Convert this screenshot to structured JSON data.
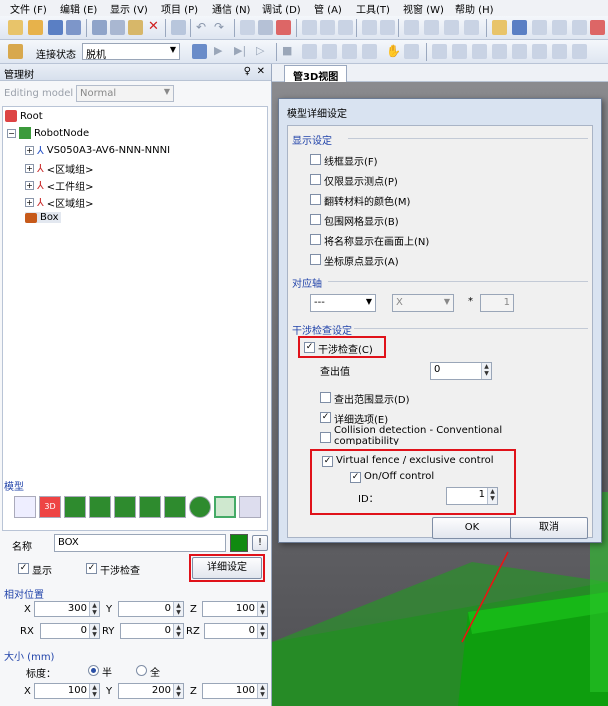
{
  "menu": [
    "文件 (F)",
    "编辑 (E)",
    "显示 (V)",
    "项目 (P)",
    "通信 (N)",
    "调试 (D)",
    "管 (A)",
    "工具(T)",
    "视窗 (W)",
    "帮助 (H)"
  ],
  "toolbar2": {
    "conn_label": "连接状态",
    "conn_value": "脱机"
  },
  "left": {
    "title": "管理树",
    "pin": "♀",
    "close": "✕",
    "editing_label": "Editing model",
    "editing_value": "Normal",
    "tree": {
      "root": "Root",
      "robotnode": "RobotNode",
      "robot": "VS050A3-AV6-NNN-NNNI",
      "group1": "<区域组>",
      "group2": "<工件组>",
      "group3": "<区域组>",
      "box": "Box"
    },
    "model_section": "模型",
    "name_label": "名称",
    "name_value": "BOX",
    "color_btn": "!",
    "show_label": "显示",
    "interference_label": "干涉检查",
    "detail_btn": "详细设定",
    "relpos_section": "相对位置",
    "pos": {
      "x_label": "X",
      "x": "300",
      "y_label": "Y",
      "y": "0",
      "z_label": "Z",
      "z": "100",
      "rx_label": "RX",
      "rx": "0",
      "ry_label": "RY",
      "ry": "0",
      "rz_label": "RZ",
      "rz": "0"
    },
    "size_section": "大小 (mm)",
    "scale_label": "标度：",
    "half_label": "半",
    "full_label": "全",
    "size": {
      "x_label": "X",
      "x": "100",
      "y_label": "Y",
      "y": "200",
      "z_label": "Z",
      "z": "100"
    }
  },
  "right": {
    "tab": "管3D视图"
  },
  "dialog": {
    "title": "模型详细设定",
    "display_group": "显示设定",
    "display_opts": [
      "线框显示(F)",
      "仅限显示测点(P)",
      "翻转材料的颜色(M)",
      "包围网格显示(B)",
      "将名称显示在画面上(N)",
      "坐标原点显示(A)"
    ],
    "axis_group": "对应轴",
    "axis_select": "---",
    "axis_x": "X",
    "axis_star": "*",
    "axis_num": "1",
    "intf_group": "干涉检查设定",
    "intf_check": "干涉检查(C)",
    "detect_label": "查出值",
    "detect_value": "0",
    "range_show": "查出范围显示(D)",
    "detail_opt": "详细选项(E)",
    "collision": "Collision detection - Conventional compatibility",
    "vfence": "Virtual fence / exclusive control",
    "onoff": "On/Off control",
    "id_label": "ID：",
    "id_value": "1",
    "ok": "OK",
    "cancel": "取消"
  }
}
